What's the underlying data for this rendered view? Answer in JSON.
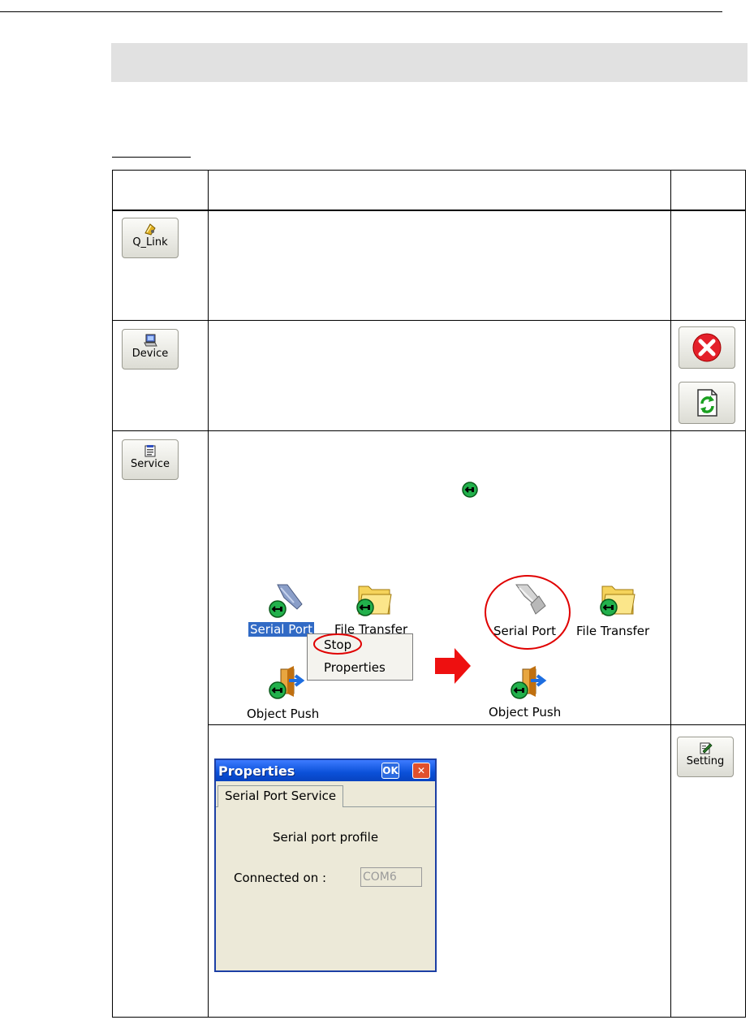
{
  "page": {
    "top_rule": true
  },
  "table": {
    "rows": [
      {
        "button": {
          "label": "Q_Link",
          "icon": "qlink-icon"
        }
      },
      {
        "button": {
          "label": "Device",
          "icon": "device-icon"
        },
        "side_icons": [
          "close-circle-icon",
          "refresh-icon"
        ]
      },
      {
        "button": {
          "label": "Service",
          "icon": "service-icon"
        }
      },
      {
        "side_button": {
          "label": "Setting",
          "icon": "setting-icon"
        }
      }
    ]
  },
  "service_illustration": {
    "before": {
      "icons": [
        {
          "label": "Serial Port",
          "icon": "serial-port-icon",
          "selected": true
        },
        {
          "label": "File Transfer",
          "icon": "folder-icon"
        },
        {
          "label": "Object Push",
          "icon": "object-push-icon"
        }
      ],
      "context_menu": [
        "Stop",
        "Properties"
      ]
    },
    "after": {
      "icons": [
        {
          "label": "Serial Port",
          "icon": "serial-port-icon"
        },
        {
          "label": "File Transfer",
          "icon": "folder-icon"
        },
        {
          "label": "Object Push",
          "icon": "object-push-icon"
        }
      ]
    }
  },
  "properties_dialog": {
    "title": "Properties",
    "ok_label": "OK",
    "close_label": "✕",
    "tab": "Serial Port Service",
    "profile_text": "Serial port profile",
    "connected_label": "Connected on :",
    "connected_value": "COM6"
  },
  "colors": {
    "banner": "#e1e1e1",
    "titlebar": "#0a50d8",
    "highlight": "#316ac5",
    "annotation_red": "#e00000",
    "connected_green": "#22b14c"
  }
}
